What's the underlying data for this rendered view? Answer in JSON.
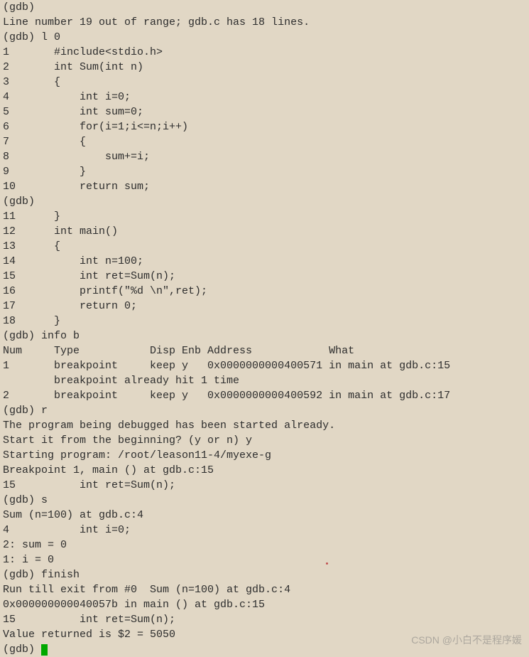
{
  "terminal": {
    "lines": [
      "(gdb)",
      "Line number 19 out of range; gdb.c has 18 lines.",
      "(gdb) l 0",
      "1       #include<stdio.h>",
      "2       int Sum(int n)",
      "3       {",
      "4           int i=0;",
      "5           int sum=0;",
      "6           for(i=1;i<=n;i++)",
      "7           {",
      "8               sum+=i;",
      "9           }",
      "10          return sum;",
      "(gdb)",
      "11      }",
      "12      int main()",
      "13      {",
      "14          int n=100;",
      "15          int ret=Sum(n);",
      "16          printf(\"%d \\n\",ret);",
      "17          return 0;",
      "18      }",
      "(gdb) info b",
      "Num     Type           Disp Enb Address            What",
      "1       breakpoint     keep y   0x0000000000400571 in main at gdb.c:15",
      "        breakpoint already hit 1 time",
      "2       breakpoint     keep y   0x0000000000400592 in main at gdb.c:17",
      "(gdb) r",
      "The program being debugged has been started already.",
      "Start it from the beginning? (y or n) y",
      "Starting program: /root/leason11-4/myexe-g",
      "",
      "Breakpoint 1, main () at gdb.c:15",
      "15          int ret=Sum(n);",
      "(gdb) s",
      "Sum (n=100) at gdb.c:4",
      "4           int i=0;",
      "2: sum = 0",
      "1: i = 0",
      "(gdb) finish",
      "Run till exit from #0  Sum (n=100) at gdb.c:4",
      "0x000000000040057b in main () at gdb.c:15",
      "15          int ret=Sum(n);",
      "Value returned is $2 = 5050"
    ],
    "prompt": "(gdb) "
  },
  "watermark": "CSDN @小白不是程序媛"
}
